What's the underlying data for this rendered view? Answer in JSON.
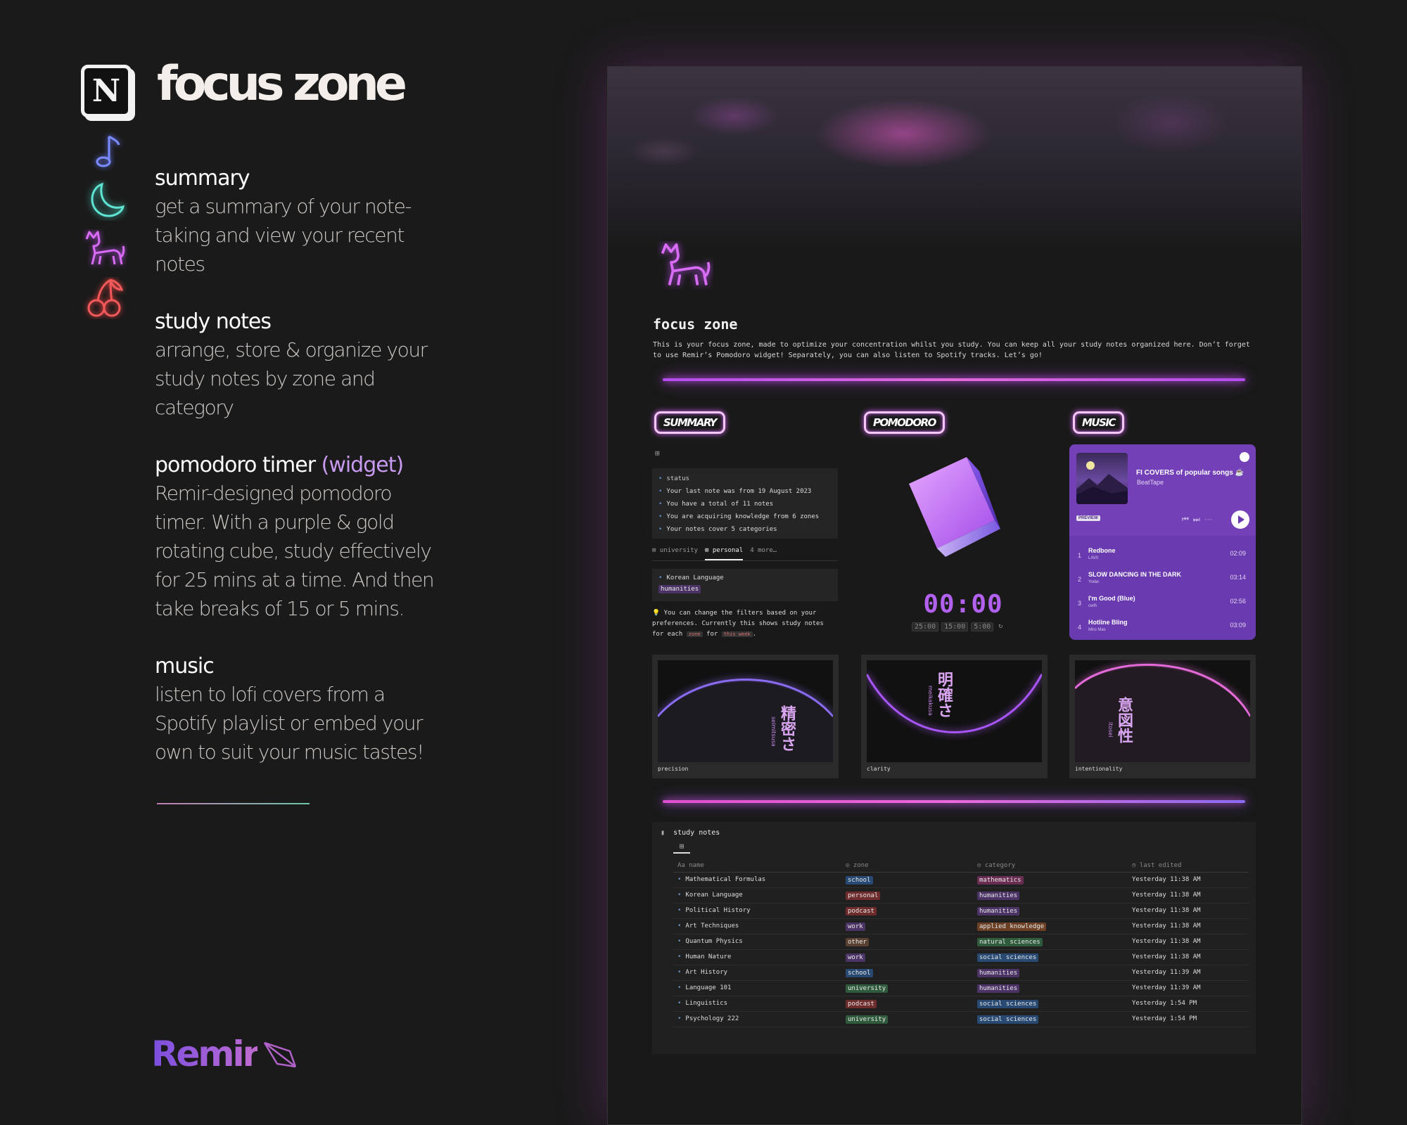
{
  "header": {
    "title": "focus zone",
    "notion_badge": "N"
  },
  "features": [
    {
      "title": "summary",
      "accent": "",
      "desc": "get a summary of your note-taking and view your recent notes"
    },
    {
      "title": "study notes",
      "accent": "",
      "desc": "arrange, store & organize your study notes by zone and category"
    },
    {
      "title": "pomodoro timer",
      "accent": "(widget)",
      "desc": "Remir-designed pomodoro timer. With a purple & gold rotating cube, study effectively for 25 mins at a time. And then take breaks of 15 or 5 mins."
    },
    {
      "title": "music",
      "accent": "",
      "desc": "listen to lofi covers from a Spotify playlist or embed your own to suit your music tastes!"
    }
  ],
  "brand": "Remir",
  "icons": [
    "music-note-icon",
    "moon-icon",
    "cat-icon",
    "cherry-icon"
  ],
  "colors": {
    "accent_purple": "#b261ee",
    "neon_pink": "#e36ad8",
    "spotify_purple": "#6a3bb0"
  },
  "page": {
    "title": "focus zone",
    "description": "This is your focus zone, made to optimize your concentration whilst you study. You can keep all your study notes organized here. Don’t forget to use Remir’s Pomodoro widget! Separately, you can also listen to Spotify tracks. Let’s go!",
    "labels": {
      "summary": "SUMMARY",
      "pomodoro": "POMODORO",
      "music": "MUSIC"
    },
    "summary": {
      "status_title": "status",
      "status_items": [
        "Your last note was from 19 August 2023",
        "You have a total of 11 notes",
        "You are acquiring knowledge from 6 zones",
        "Your notes cover 5 categories"
      ],
      "tabs": [
        "university",
        "personal",
        "4 more…"
      ],
      "note_title": "Korean Language",
      "note_tag": "humanities",
      "tip_text": "You can change the filters based on your preferences. Currently this shows study notes for each",
      "tip_code1": "zone",
      "tip_mid": "for",
      "tip_code2": "this week",
      "tip_end": "."
    },
    "pomodoro": {
      "time": "00:00",
      "presets": [
        "25:00",
        "15:00",
        "5:00"
      ]
    },
    "music": {
      "playlist": "FI COVERS of popular songs ☕",
      "artist": "BeatTape",
      "preview": "PREVIEW",
      "tracks": [
        {
          "num": "1",
          "name": "Redbone",
          "artist": "LAVII",
          "duration": "02:09"
        },
        {
          "num": "2",
          "name": "SLOW DANCING IN THE DARK",
          "artist": "Yodai",
          "duration": "03:14"
        },
        {
          "num": "3",
          "name": "I'm Good (Blue)",
          "artist": "cwlh",
          "duration": "02:56"
        },
        {
          "num": "4",
          "name": "Hotline Bling",
          "artist": "Miro Mas",
          "duration": "03:09"
        }
      ]
    },
    "gallery": [
      {
        "caption": "precision",
        "kanji": "精密さ",
        "romaji": "seimitsusa"
      },
      {
        "caption": "clarity",
        "kanji": "明確さ",
        "romaji": "meikakusa"
      },
      {
        "caption": "intentionality",
        "kanji": "意図性",
        "romaji": "itosei"
      }
    ],
    "study_notes": {
      "title": "study notes",
      "columns": [
        "Aa name",
        "zone",
        "category",
        "last edited"
      ],
      "rows": [
        {
          "name": "Mathematical Formulas",
          "zone": "school",
          "category": "mathematics",
          "edited": "Yesterday 11:38 AM"
        },
        {
          "name": "Korean Language",
          "zone": "personal",
          "category": "humanities",
          "edited": "Yesterday 11:38 AM"
        },
        {
          "name": "Political History",
          "zone": "podcast",
          "category": "humanities",
          "edited": "Yesterday 11:38 AM"
        },
        {
          "name": "Art Techniques",
          "zone": "work",
          "category": "applied knowledge",
          "edited": "Yesterday 11:38 AM"
        },
        {
          "name": "Quantum Physics",
          "zone": "other",
          "category": "natural sciences",
          "edited": "Yesterday 11:38 AM"
        },
        {
          "name": "Human Nature",
          "zone": "work",
          "category": "social sciences",
          "edited": "Yesterday 11:38 AM"
        },
        {
          "name": "Art History",
          "zone": "school",
          "category": "humanities",
          "edited": "Yesterday 11:39 AM"
        },
        {
          "name": "Language 101",
          "zone": "university",
          "category": "humanities",
          "edited": "Yesterday 11:39 AM"
        },
        {
          "name": "Linguistics",
          "zone": "podcast",
          "category": "social sciences",
          "edited": "Yesterday 1:54 PM"
        },
        {
          "name": "Psychology 222",
          "zone": "university",
          "category": "social sciences",
          "edited": "Yesterday 1:54 PM"
        }
      ]
    }
  }
}
